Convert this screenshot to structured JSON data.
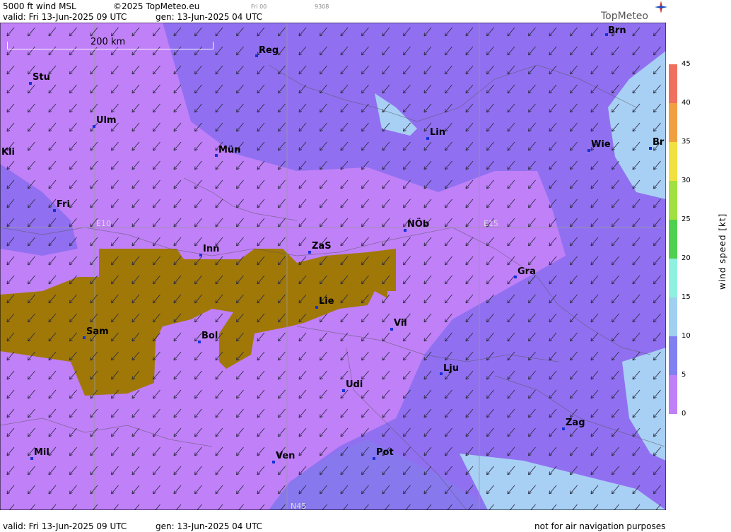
{
  "header": {
    "product": "5000 ft wind MSL",
    "copyright": "©2025 TopMeteo.eu",
    "valid": "valid:  Fri  13-Jun-2025  09 UTC",
    "gen": "gen: 13-Jun-2025 04 UTC",
    "small_tag": "Fri 00",
    "small_num": "9308"
  },
  "logo": "TopMeteo",
  "scale": "200 km",
  "grid_labels": [
    "E10",
    "E15",
    "N45"
  ],
  "cities": [
    {
      "name": "Brn"
    },
    {
      "name": "Reg"
    },
    {
      "name": "Stu"
    },
    {
      "name": "Ulm"
    },
    {
      "name": "Lin"
    },
    {
      "name": "Wie"
    },
    {
      "name": "Br"
    },
    {
      "name": "Mün"
    },
    {
      "name": "Kli"
    },
    {
      "name": "Fri"
    },
    {
      "name": "NÖb"
    },
    {
      "name": "Inn"
    },
    {
      "name": "ZaS"
    },
    {
      "name": "Gra"
    },
    {
      "name": "Lie"
    },
    {
      "name": "Vil"
    },
    {
      "name": "Sam"
    },
    {
      "name": "Bol"
    },
    {
      "name": "Lju"
    },
    {
      "name": "Udi"
    },
    {
      "name": "Zag"
    },
    {
      "name": "Mil"
    },
    {
      "name": "Pot"
    },
    {
      "name": "Ven"
    }
  ],
  "legend": {
    "title": "wind  speed  [kt]",
    "ticks": [
      "45",
      "40",
      "35",
      "30",
      "25",
      "20",
      "15",
      "10",
      "5",
      "0"
    ],
    "colors": [
      "#f07060",
      "#f0a040",
      "#f0e040",
      "#a0e040",
      "#50d050",
      "#90f0d0",
      "#a0d8f0",
      "#8080f0",
      "#b070f0"
    ]
  },
  "footer": {
    "valid": "valid:  Fri  13-Jun-2025  09 UTC",
    "gen": "gen: 13-Jun-2025 04 UTC",
    "disclaimer": "not for air navigation purposes"
  },
  "colors": {
    "calm": "#c080f8",
    "light": "#a070f0",
    "moderate": "#8878ee",
    "fresh": "#a8d0f4",
    "terrain": "#a07808"
  }
}
